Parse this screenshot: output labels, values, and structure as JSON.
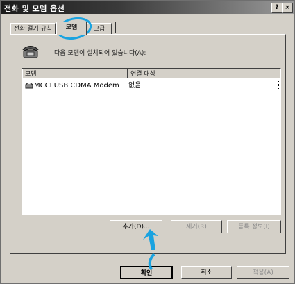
{
  "window": {
    "title": "전화 및 모뎀 옵션",
    "help_glyph": "?",
    "close_glyph": "×"
  },
  "tabs": [
    {
      "label": "전화 걸기 규칙",
      "selected": false
    },
    {
      "label": "모뎀",
      "selected": true
    },
    {
      "label": "고급",
      "selected": false
    }
  ],
  "info_text": "다음 모뎀이 설치되어 있습니다(A):",
  "list": {
    "columns": [
      "모뎀",
      "연결 대상"
    ],
    "rows": [
      {
        "name": "MCCI USB CDMA Modem",
        "port": "없음"
      }
    ]
  },
  "buttons": {
    "add": "추가(D)...",
    "remove": "제거(R)",
    "properties": "등록 정보(I)",
    "ok": "확인",
    "cancel": "취소",
    "apply": "적용(A)"
  },
  "colors": {
    "annotation": "#1aa3e0",
    "dialog_bg": "#d4d0c8"
  }
}
